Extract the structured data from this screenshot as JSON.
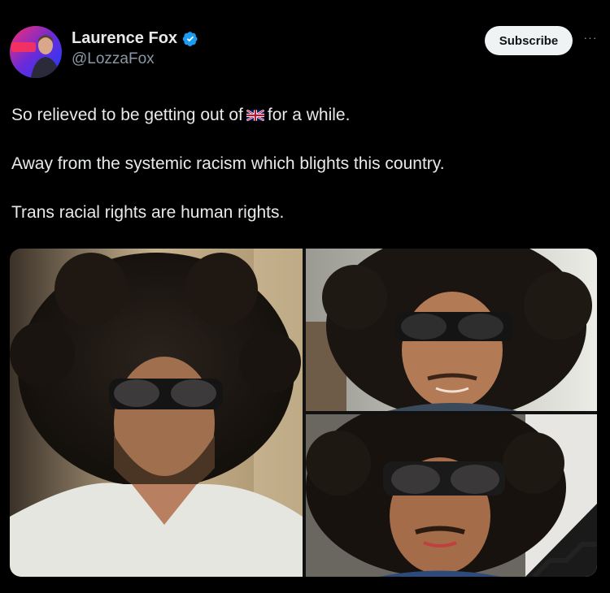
{
  "author": {
    "name": "Laurence Fox",
    "handle": "@LozzaFox",
    "verified": true,
    "avatar_icon": "profile-photo"
  },
  "actions": {
    "subscribe_label": "Subscribe",
    "more_label": "···"
  },
  "tweet": {
    "line1_before": "So relieved to be getting out of",
    "flag_icon": "uk-flag-emoji",
    "line1_after": "for a while.",
    "line2": "Away from the systemic racism which blights this country.",
    "line3": "Trans racial rights are human rights."
  },
  "media": {
    "count": 3,
    "images": [
      "man-in-afro-wig-sunglasses-white-shirt",
      "man-in-afro-wig-sunglasses-smiling",
      "man-in-afro-wig-sunglasses-mustache"
    ]
  },
  "colors": {
    "background": "#000000",
    "text": "#e7e9ea",
    "secondary_text": "#8b98a5",
    "verified_blue": "#1d9bf0",
    "subscribe_bg": "#eff3f4"
  }
}
